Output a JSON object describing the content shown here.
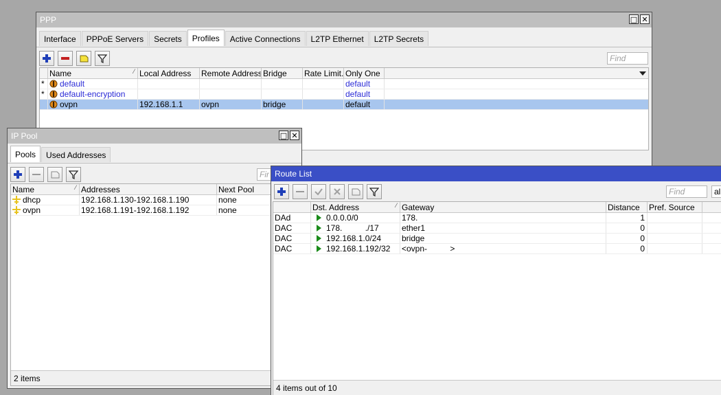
{
  "ppp": {
    "title": "PPP",
    "tabs": [
      "Interface",
      "PPPoE Servers",
      "Secrets",
      "Profiles",
      "Active Connections",
      "L2TP Ethernet",
      "L2TP Secrets"
    ],
    "find_placeholder": "Find",
    "columns": [
      "Name",
      "Local Address",
      "Remote Address",
      "Bridge",
      "Rate Limit...",
      "Only One"
    ],
    "rows": [
      {
        "flag": "*",
        "name": "default",
        "local": "",
        "remote": "",
        "bridge": "",
        "rate": "",
        "only_one": "default"
      },
      {
        "flag": "*",
        "name": "default-encryption",
        "local": "",
        "remote": "",
        "bridge": "",
        "rate": "",
        "only_one": "default"
      },
      {
        "flag": "",
        "name": "ovpn",
        "local": "192.168.1.1",
        "remote": "ovpn",
        "bridge": "bridge",
        "rate": "",
        "only_one": "default"
      }
    ]
  },
  "pool": {
    "title": "IP Pool",
    "tabs": [
      "Pools",
      "Used Addresses"
    ],
    "find_placeholder": "Fir",
    "columns": [
      "Name",
      "Addresses",
      "Next Pool"
    ],
    "rows": [
      {
        "name": "dhcp",
        "addresses": "192.168.1.130-192.168.1.190",
        "next": "none"
      },
      {
        "name": "ovpn",
        "addresses": "192.168.1.191-192.168.1.192",
        "next": "none"
      }
    ],
    "status": "2 items"
  },
  "routes": {
    "title": "Route List",
    "find_placeholder": "Find",
    "filter_value": "all",
    "columns": [
      "",
      "Dst. Address",
      "Gateway",
      "Distance",
      "Pref. Source"
    ],
    "rows": [
      {
        "flags": "DAd",
        "dst": "0.0.0.0/0",
        "gateway": "178.",
        "distance": "1",
        "pref": ""
      },
      {
        "flags": "DAC",
        "dst": "178.          ./17",
        "gateway": "ether1",
        "distance": "0",
        "pref": ""
      },
      {
        "flags": "DAC",
        "dst": "192.168.1.0/24",
        "gateway": "bridge",
        "distance": "0",
        "pref": ""
      },
      {
        "flags": "DAC",
        "dst": "192.168.1.192/32",
        "gateway": "<ovpn-          >",
        "distance": "0",
        "pref": ""
      }
    ],
    "status": "4 items out of 10"
  },
  "icons": {
    "add": "plus-icon",
    "remove": "minus-icon",
    "enable": "check-icon",
    "disable": "x-icon",
    "comment": "note-icon",
    "filter": "filter-icon"
  },
  "colors": {
    "active_title": "#3a4fc6",
    "inactive_title": "#bfbfbf",
    "selected_row": "#a8c6ee",
    "add_blue": "#1f3fb8",
    "remove_red": "#c42020",
    "route_arrow": "#1a8a1a"
  }
}
